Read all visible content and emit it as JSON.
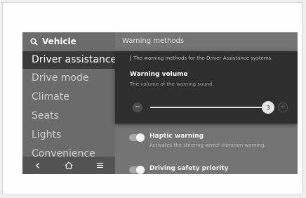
{
  "sidebar": {
    "search_title": "Vehicle",
    "items": [
      {
        "label": "Driver assistance",
        "active": true
      },
      {
        "label": "Drive mode",
        "active": false
      },
      {
        "label": "Climate",
        "active": false
      },
      {
        "label": "Seats",
        "active": false
      },
      {
        "label": "Lights",
        "active": false
      },
      {
        "label": "Convenience",
        "active": false
      }
    ],
    "bottom_nav": [
      "back-icon",
      "home-icon",
      "menu-icon"
    ]
  },
  "main": {
    "header": "Warning methods",
    "popup": {
      "description": "The warning methods for the Driver Assistance systems.",
      "title": "Warning volume",
      "subtitle": "The volume of the warning sound.",
      "minus_symbol": "−",
      "plus_symbol": "+",
      "volume": "3",
      "volume_level_fraction": 0.97
    },
    "settings": [
      {
        "label": "Haptic warning",
        "desc": "Activates the steering wheel vibration warning.",
        "enabled": true
      },
      {
        "label": "Driving safety priority",
        "desc": "",
        "enabled": true
      }
    ]
  },
  "colors": {
    "screen_bg": "#747474",
    "active_item_bg": "#3a3a3a",
    "popup_bg": "#2e2e2e"
  }
}
